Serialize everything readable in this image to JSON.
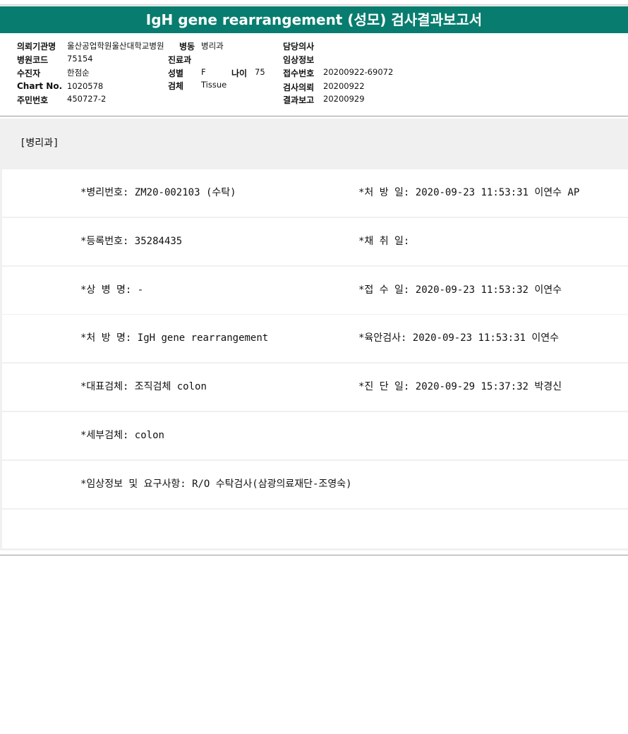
{
  "title": "IgH gene rearrangement (성모) 검사결과보고서",
  "header": {
    "institution_label": "의뢰기관명",
    "institution_value": "울산공업학원울산대학교병원",
    "ward_label": "병동",
    "ward_value": "병리과",
    "doctor_label": "담당의사",
    "doctor_value": "",
    "hospital_code_label": "병원코드",
    "hospital_code_value": "75154",
    "dept_label": "진료과",
    "dept_value": "",
    "clinical_label": "임상정보",
    "clinical_value": "",
    "patient_label": "수진자",
    "patient_value": "한점순",
    "sex_label": "성별",
    "sex_value": "F",
    "age_label": "나이",
    "age_value": "75",
    "receipt_no_label": "접수번호",
    "receipt_no_value": "20200922-69072",
    "chart_label": "Chart No.",
    "chart_value": "1020578",
    "specimen_label": "검체",
    "specimen_value": "Tissue",
    "request_label": "검사의뢰",
    "request_value": "20200922",
    "id_label": "주민번호",
    "id_value": "450727-2",
    "report_label": "결과보고",
    "report_value": "20200929"
  },
  "section_title": "[병리과]",
  "rows": [
    {
      "left": "*병리번호: ZM20-002103 (수탁)",
      "right": "*처 방 일: 2020-09-23 11:53:31  이연수 AP"
    },
    {
      "left": "*등록번호: 35284435",
      "right": "*채 취 일:"
    },
    {
      "left": "*상 병 명: -",
      "right": "*접 수 일: 2020-09-23 11:53:32  이연수"
    },
    {
      "left": "*처 방 명: IgH gene rearrangement",
      "right": "*육안검사: 2020-09-23 11:53:31  이연수"
    },
    {
      "left": "*대표검체: 조직검체 colon",
      "right": "*진 단 일: 2020-09-29 15:37:32  박경신"
    },
    {
      "left": "*세부검체: colon",
      "right": ""
    },
    {
      "left": "*임상정보 및 요구사항: R/O 수탁검사(삼광의료재단-조영숙)",
      "right": ""
    }
  ]
}
